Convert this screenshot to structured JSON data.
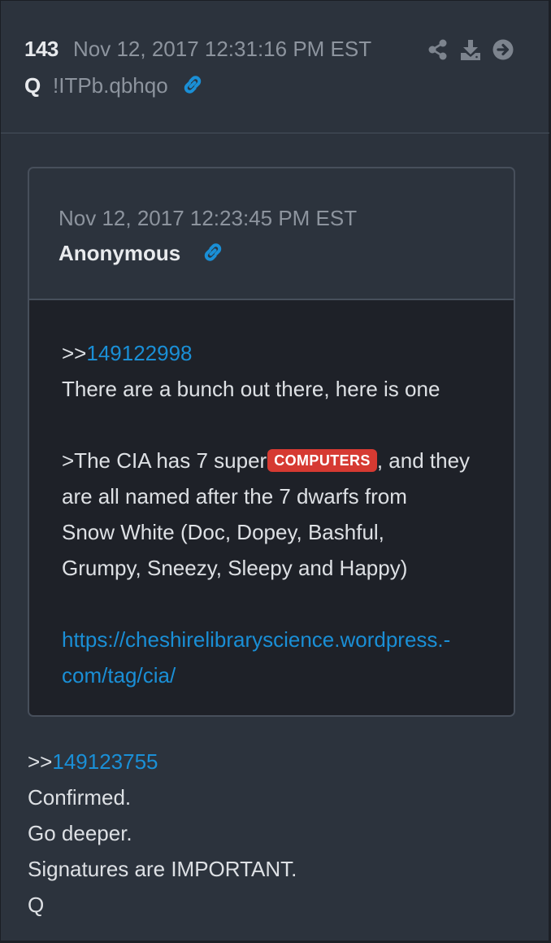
{
  "post": {
    "number": "143",
    "date": "Nov 12, 2017 12:31:16 PM EST",
    "author": "Q",
    "tripcode": "!ITPb.qbhqo",
    "toolbar": [
      "share-icon",
      "download-icon",
      "forward-icon"
    ]
  },
  "quoted": {
    "date": "Nov 12, 2017 12:23:45 PM EST",
    "author": "Anonymous",
    "quote_prefix": ">>",
    "quote_ref": "149122998",
    "line1": "There are a bunch out there, here is one",
    "line2_before": ">The CIA has 7 super",
    "line2_badge": "COMPUTERS",
    "line2_after": ", and they",
    "line3": "are all named after the 7 dwarfs from",
    "line4": "Snow White (Doc, Dopey, Bashful,",
    "line5": "Grumpy, Sneezy, Sleepy and Happy)",
    "url_line1": "https://cheshirelibraryscience.wordpress.-",
    "url_line2": "com/tag/cia/"
  },
  "reply": {
    "quote_prefix": ">>",
    "quote_ref": "149123755",
    "line1": "Confirmed.",
    "line2": "Go deeper.",
    "line3": "Signatures are IMPORTANT.",
    "line4": "Q"
  },
  "colors": {
    "background": "#2c333d",
    "quoted_body": "#1e2128",
    "link": "#1a8fd6",
    "badge": "#d63a32",
    "muted_text": "#8d949e"
  }
}
